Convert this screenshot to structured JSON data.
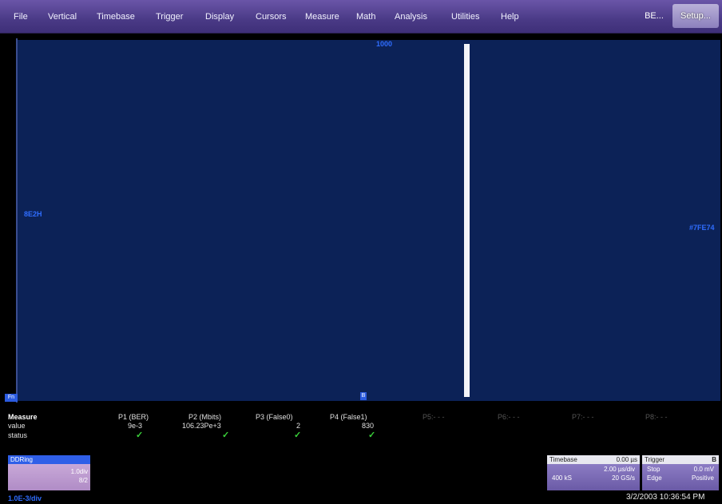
{
  "menu": {
    "items": [
      "File",
      "Vertical",
      "Timebase",
      "Trigger",
      "Display",
      "Cursors",
      "Measure",
      "Math",
      "Analysis",
      "Utilities",
      "Help"
    ],
    "be_label": "BE...",
    "setup_label": "Setup..."
  },
  "grid": {
    "top_label": "1000",
    "left_label": "8E2H",
    "right_label": "#7FE74",
    "channel_marker": "Fn",
    "trigger_marker": "B"
  },
  "measure": {
    "title": "Measure",
    "row_labels": [
      "value",
      "status"
    ],
    "columns": [
      {
        "header": "P1 (BER)",
        "value": "9e-3",
        "status": "✓"
      },
      {
        "header": "P2 (Mbits)",
        "value": "106.23Pe+3",
        "status": "✓"
      },
      {
        "header": "P3 (False0)",
        "value": "2",
        "status": "✓"
      },
      {
        "header": "P4 (False1)",
        "value": "830",
        "status": "✓"
      },
      {
        "header": "P5:- - -",
        "value": "",
        "status": ""
      },
      {
        "header": "P6:- - -",
        "value": "",
        "status": ""
      },
      {
        "header": "P7:- - -",
        "value": "",
        "status": ""
      },
      {
        "header": "P8:- - -",
        "value": "",
        "status": ""
      }
    ]
  },
  "channel_descriptor": {
    "title": "DDRing",
    "line1": "1.0div",
    "line2": "8/2"
  },
  "bottom_left_label": "1.0E-3/div",
  "timebase": {
    "title": "Timebase",
    "delay": "0.00 µs",
    "per_div": "2.00 µs/div",
    "samples": "400 kS",
    "rate": "20 GS/s"
  },
  "trigger": {
    "title": "Trigger",
    "channel": "B",
    "mode": "Stop",
    "level": "0.0 mV",
    "type": "Edge",
    "slope": "Positive"
  },
  "timestamp": "3/2/2003 10:36:54 PM"
}
